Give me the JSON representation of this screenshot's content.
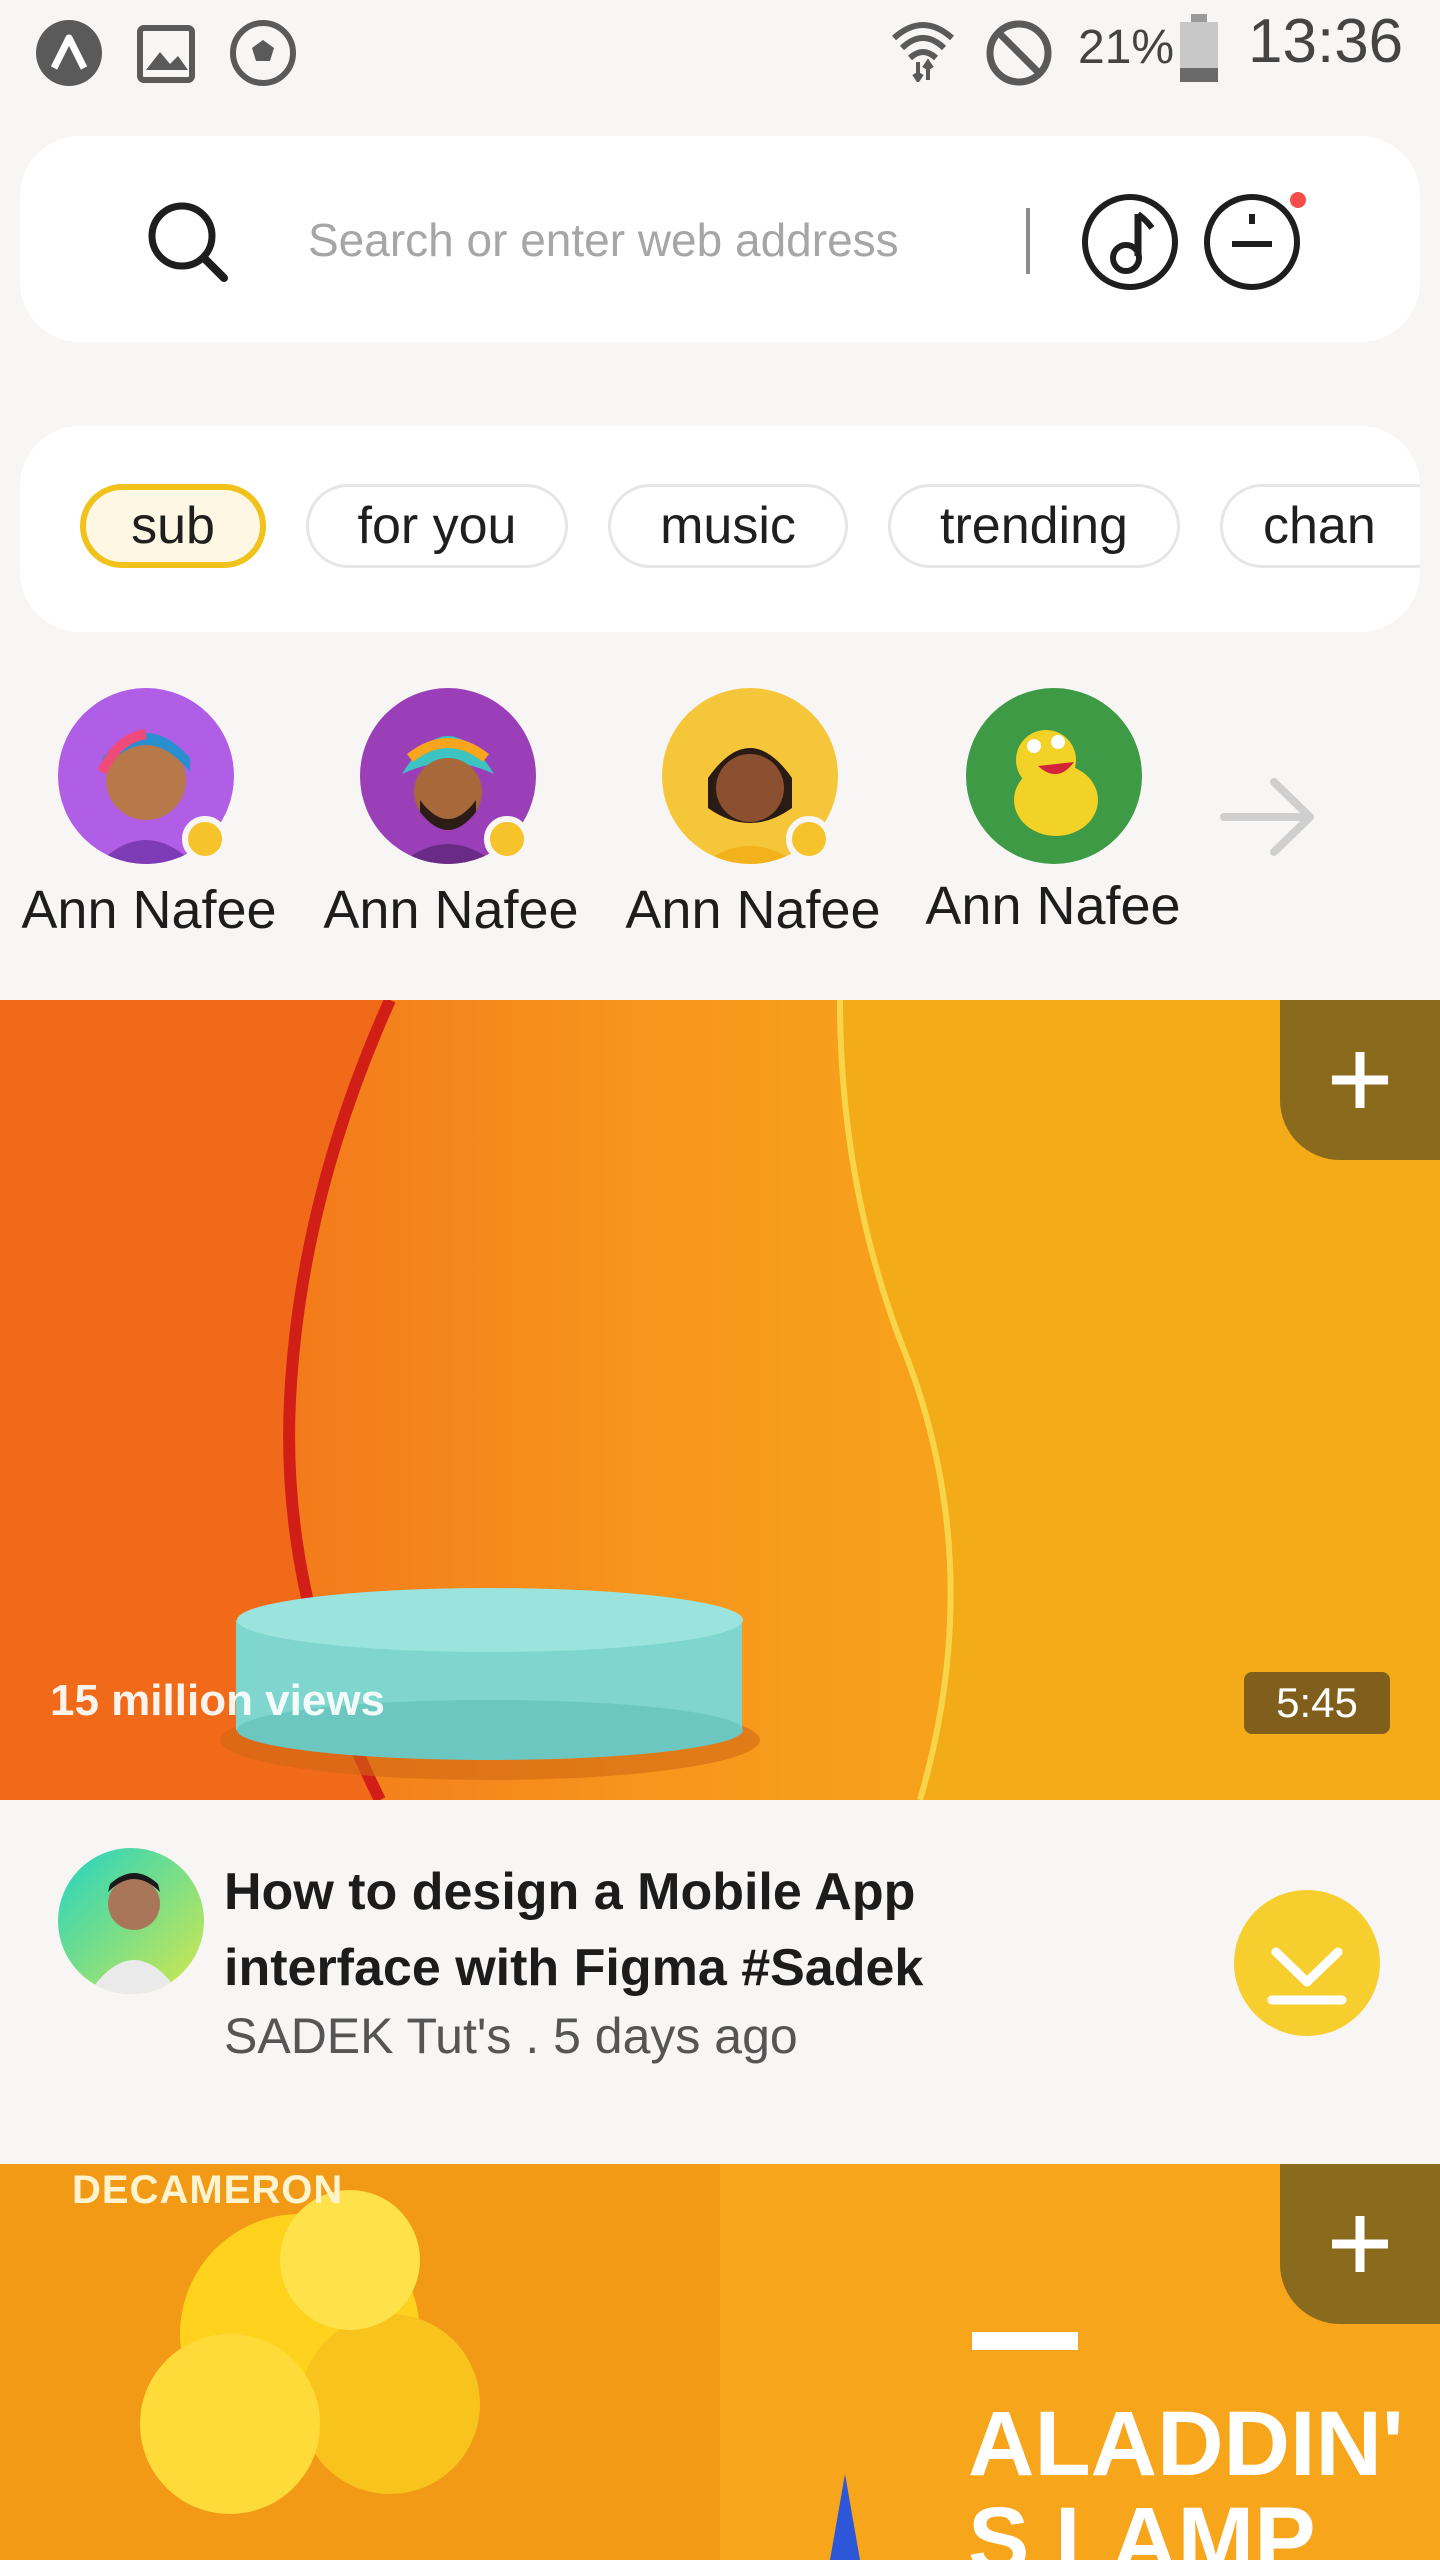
{
  "status_bar": {
    "battery": "21%",
    "time": "13:36",
    "left_icons": [
      "app-logo-icon",
      "image-icon",
      "soccer-ball-icon"
    ],
    "right_icons": [
      "wifi-icon",
      "do-not-disturb-icon",
      "battery-icon"
    ]
  },
  "search": {
    "placeholder": "Search or enter web address",
    "icons": [
      "search-icon",
      "music-note-icon",
      "profile-menu-icon"
    ]
  },
  "tabs": [
    {
      "label": "sub",
      "active": true
    },
    {
      "label": "for you",
      "active": false
    },
    {
      "label": "music",
      "active": false
    },
    {
      "label": "trending",
      "active": false
    },
    {
      "label": "chan",
      "active": false
    }
  ],
  "creators": [
    {
      "name": "Ann Nafee"
    },
    {
      "name": "Ann Nafee"
    },
    {
      "name": "Ann Nafee"
    },
    {
      "name": "Ann Nafee"
    }
  ],
  "videos": [
    {
      "views": "15 million views",
      "duration": "5:45",
      "title": "How to design a Mobile App interface with Figma #Sadek",
      "channel_line": "SADEK Tut's . 5 days ago"
    },
    {
      "brand_text": "DECAMERON",
      "title_text": "ALADDIN' S LAMP"
    }
  ],
  "colors": {
    "accent": "#f1c21b",
    "background": "#f7f6f4",
    "thumb_orange": "#f08a12"
  }
}
